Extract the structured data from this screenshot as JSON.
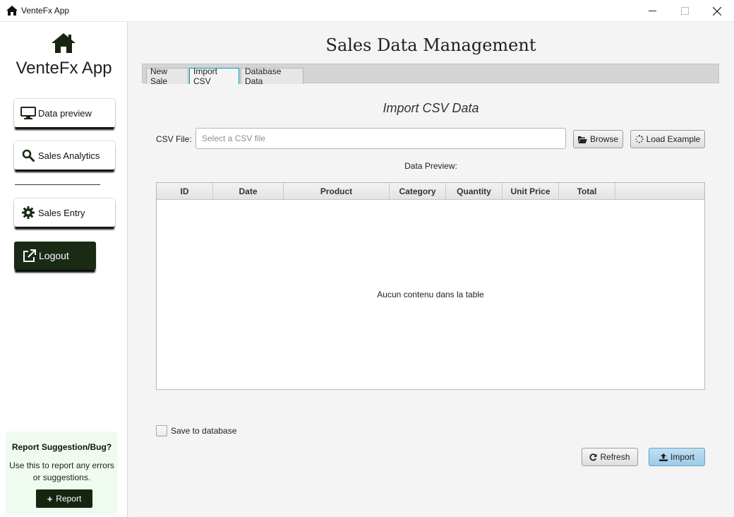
{
  "window": {
    "title": "VenteFx App",
    "icon": "home-icon",
    "controls": [
      "minimize-icon",
      "maximize-icon",
      "close-icon"
    ]
  },
  "sidebar": {
    "brand": "VenteFx App",
    "brand_icon": "home-icon",
    "nav": [
      {
        "label": "Data preview",
        "icon": "monitor-icon"
      },
      {
        "label": "Sales Analytics",
        "icon": "search-icon"
      },
      {
        "label": "Sales Entry",
        "icon": "gear-icon"
      }
    ],
    "logout": {
      "label": "Logout",
      "icon": "external-link-icon"
    },
    "report": {
      "title": "Report Suggestion/Bug?",
      "description": "Use this to report any errors or suggestions.",
      "button": "Report",
      "button_icon": "plus-icon"
    }
  },
  "main": {
    "title": "Sales Data Management",
    "tabs": [
      {
        "label": "New Sale",
        "selected": false
      },
      {
        "label": "Import CSV",
        "selected": true
      },
      {
        "label": "Database Data",
        "selected": false
      }
    ],
    "section_title": "Import CSV Data",
    "csv_label": "CSV File:",
    "csv_input": {
      "value": "",
      "placeholder": "Select a CSV file"
    },
    "browse_button": {
      "label": "Browse",
      "icon": "folder-open-icon"
    },
    "example_button": {
      "label": "Load Example",
      "icon": "spinner-icon"
    },
    "preview_label": "Data Preview:",
    "table": {
      "columns": [
        "ID",
        "Date",
        "Product",
        "Category",
        "Quantity",
        "Unit Price",
        "Total"
      ],
      "rows": [],
      "empty_message": "Aucun contenu dans la table"
    },
    "save_checkbox": {
      "label": "Save to database",
      "checked": false
    },
    "refresh_button": {
      "label": "Refresh",
      "icon": "refresh-icon"
    },
    "import_button": {
      "label": "Import",
      "icon": "upload-icon"
    }
  },
  "colors": {
    "sidebar_dark": "#1a2a15",
    "tab_selected_border": "#0096c9",
    "import_button": "#a8d2ec",
    "report_box_bg": "#f0fbf0",
    "main_bg": "#f4f4f4"
  }
}
